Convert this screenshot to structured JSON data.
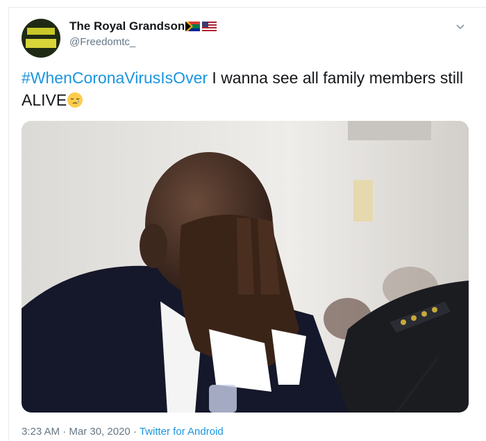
{
  "user": {
    "display_name": "The Royal Grandson",
    "handle": "@Freedomtc_"
  },
  "tweet": {
    "hashtag": "#WhenCoronaVirusIsOver",
    "text": " I wanna see all family members still ALIVE",
    "emoji_icon": "crying-face-icon"
  },
  "photo": {
    "description_icon": "man-covering-face-photo"
  },
  "meta": {
    "time": "3:23 AM",
    "separator1": " · ",
    "date": "Mar 30, 2020",
    "separator2": " · ",
    "source": "Twitter for Android"
  },
  "colors": {
    "link": "#1b95e0",
    "secondary_text": "#657786"
  }
}
